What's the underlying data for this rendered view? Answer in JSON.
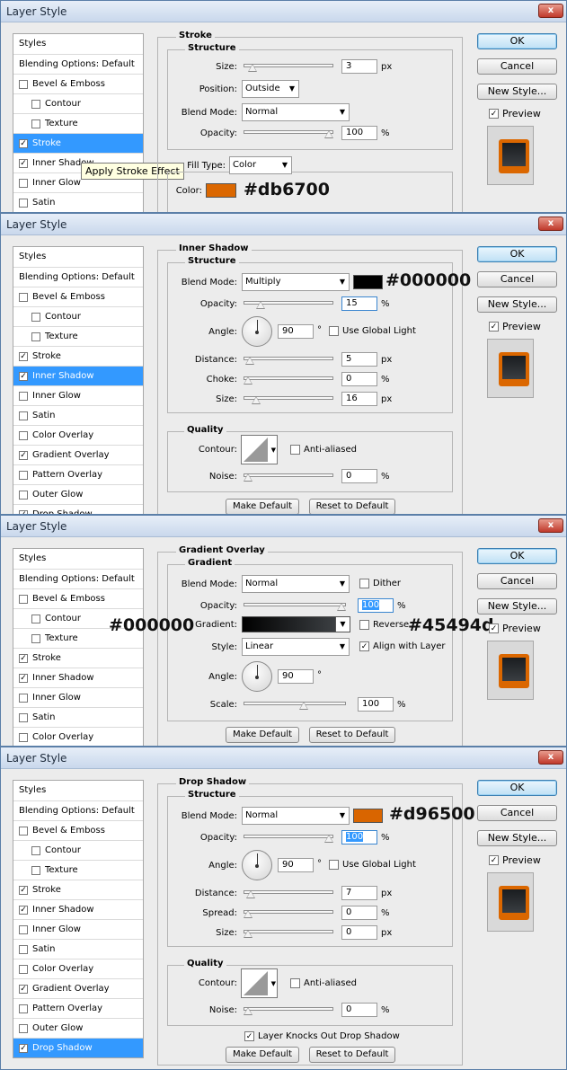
{
  "panels": [
    {
      "title": "Layer Style",
      "close_label": "x",
      "section_title": "Stroke",
      "subsection_title": "Structure",
      "sidebar": [
        {
          "label": "Styles",
          "type": "header"
        },
        {
          "label": "Blending Options: Default",
          "type": "header"
        },
        {
          "label": "Bevel & Emboss",
          "checked": false
        },
        {
          "label": "Contour",
          "checked": false,
          "indent": true
        },
        {
          "label": "Texture",
          "checked": false,
          "indent": true
        },
        {
          "label": "Stroke",
          "checked": true,
          "selected": true
        },
        {
          "label": "Inner Shadow",
          "checked": true
        },
        {
          "label": "Inner Glow",
          "checked": false
        },
        {
          "label": "Satin",
          "checked": false
        }
      ],
      "tooltip": "Apply Stroke Effect",
      "fields": {
        "size_label": "Size:",
        "size_value": "3",
        "size_unit": "px",
        "size_pos": 0.05,
        "position_label": "Position:",
        "position_value": "Outside",
        "blend_label": "Blend Mode:",
        "blend_value": "Normal",
        "opacity_label": "Opacity:",
        "opacity_value": "100",
        "opacity_unit": "%",
        "opacity_pos": 1.0,
        "fill_label": "Fill Type:",
        "fill_value": "Color",
        "color_label": "Color:",
        "color_hex": "#db6700"
      },
      "annotation": "#db6700",
      "buttons": {
        "ok": "OK",
        "cancel": "Cancel",
        "new_style": "New Style...",
        "preview": "Preview"
      }
    },
    {
      "title": "Layer Style",
      "close_label": "x",
      "section_title": "Inner Shadow",
      "subsection_title": "Structure",
      "quality_title": "Quality",
      "sidebar": [
        {
          "label": "Styles",
          "type": "header"
        },
        {
          "label": "Blending Options: Default",
          "type": "header"
        },
        {
          "label": "Bevel & Emboss",
          "checked": false
        },
        {
          "label": "Contour",
          "checked": false,
          "indent": true
        },
        {
          "label": "Texture",
          "checked": false,
          "indent": true
        },
        {
          "label": "Stroke",
          "checked": true
        },
        {
          "label": "Inner Shadow",
          "checked": true,
          "selected": true
        },
        {
          "label": "Inner Glow",
          "checked": false
        },
        {
          "label": "Satin",
          "checked": false
        },
        {
          "label": "Color Overlay",
          "checked": false
        },
        {
          "label": "Gradient Overlay",
          "checked": true
        },
        {
          "label": "Pattern Overlay",
          "checked": false
        },
        {
          "label": "Outer Glow",
          "checked": false
        },
        {
          "label": "Drop Shadow",
          "checked": true
        }
      ],
      "fields": {
        "blend_label": "Blend Mode:",
        "blend_value": "Multiply",
        "blend_color": "#000000",
        "opacity_label": "Opacity:",
        "opacity_value": "15",
        "opacity_unit": "%",
        "opacity_pos": 0.15,
        "angle_label": "Angle:",
        "angle_value": "90",
        "angle_unit": "°",
        "global_light": "Use Global Light",
        "distance_label": "Distance:",
        "distance_value": "5",
        "distance_unit": "px",
        "distance_pos": 0.02,
        "choke_label": "Choke:",
        "choke_value": "0",
        "choke_unit": "%",
        "choke_pos": 0.0,
        "size_label": "Size:",
        "size_value": "16",
        "size_unit": "px",
        "size_pos": 0.1,
        "contour_label": "Contour:",
        "anti_aliased": "Anti-aliased",
        "noise_label": "Noise:",
        "noise_value": "0",
        "noise_unit": "%",
        "noise_pos": 0.0,
        "make_default": "Make Default",
        "reset_default": "Reset to Default"
      },
      "annotation": "#000000",
      "buttons": {
        "ok": "OK",
        "cancel": "Cancel",
        "new_style": "New Style...",
        "preview": "Preview"
      }
    },
    {
      "title": "Layer Style",
      "close_label": "x",
      "section_title": "Gradient Overlay",
      "subsection_title": "Gradient",
      "sidebar": [
        {
          "label": "Styles",
          "type": "header"
        },
        {
          "label": "Blending Options: Default",
          "type": "header"
        },
        {
          "label": "Bevel & Emboss",
          "checked": false
        },
        {
          "label": "Contour",
          "checked": false,
          "indent": true
        },
        {
          "label": "Texture",
          "checked": false,
          "indent": true
        },
        {
          "label": "Stroke",
          "checked": true
        },
        {
          "label": "Inner Shadow",
          "checked": true
        },
        {
          "label": "Inner Glow",
          "checked": false
        },
        {
          "label": "Satin",
          "checked": false
        },
        {
          "label": "Color Overlay",
          "checked": false
        }
      ],
      "fields": {
        "blend_label": "Blend Mode:",
        "blend_value": "Normal",
        "dither": "Dither",
        "opacity_label": "Opacity:",
        "opacity_value": "100",
        "opacity_unit": "%",
        "opacity_pos": 1.0,
        "gradient_label": "Gradient:",
        "reverse": "Reverse",
        "gradient_start": "#000000",
        "gradient_end": "#45494d",
        "style_label": "Style:",
        "style_value": "Linear",
        "align_layer": "Align with Layer",
        "angle_label": "Angle:",
        "angle_value": "90",
        "angle_unit": "°",
        "scale_label": "Scale:",
        "scale_value": "100",
        "scale_unit": "%",
        "scale_pos": 0.6,
        "make_default": "Make Default",
        "reset_default": "Reset to Default"
      },
      "annotation_left": "#000000",
      "annotation_right": "#45494d",
      "buttons": {
        "ok": "OK",
        "cancel": "Cancel",
        "new_style": "New Style...",
        "preview": "Preview"
      }
    },
    {
      "title": "Layer Style",
      "close_label": "x",
      "section_title": "Drop Shadow",
      "subsection_title": "Structure",
      "quality_title": "Quality",
      "sidebar": [
        {
          "label": "Styles",
          "type": "header"
        },
        {
          "label": "Blending Options: Default",
          "type": "header"
        },
        {
          "label": "Bevel & Emboss",
          "checked": false
        },
        {
          "label": "Contour",
          "checked": false,
          "indent": true
        },
        {
          "label": "Texture",
          "checked": false,
          "indent": true
        },
        {
          "label": "Stroke",
          "checked": true
        },
        {
          "label": "Inner Shadow",
          "checked": true
        },
        {
          "label": "Inner Glow",
          "checked": false
        },
        {
          "label": "Satin",
          "checked": false
        },
        {
          "label": "Color Overlay",
          "checked": false
        },
        {
          "label": "Gradient Overlay",
          "checked": true
        },
        {
          "label": "Pattern Overlay",
          "checked": false
        },
        {
          "label": "Outer Glow",
          "checked": false
        },
        {
          "label": "Drop Shadow",
          "checked": true,
          "selected": true
        }
      ],
      "fields": {
        "blend_label": "Blend Mode:",
        "blend_value": "Normal",
        "blend_color": "#d96500",
        "opacity_label": "Opacity:",
        "opacity_value": "100",
        "opacity_unit": "%",
        "opacity_pos": 1.0,
        "angle_label": "Angle:",
        "angle_value": "90",
        "angle_unit": "°",
        "global_light": "Use Global Light",
        "distance_label": "Distance:",
        "distance_value": "7",
        "distance_unit": "px",
        "distance_pos": 0.03,
        "spread_label": "Spread:",
        "spread_value": "0",
        "spread_unit": "%",
        "spread_pos": 0.0,
        "size_label": "Size:",
        "size_value": "0",
        "size_unit": "px",
        "size_pos": 0.0,
        "contour_label": "Contour:",
        "anti_aliased": "Anti-aliased",
        "noise_label": "Noise:",
        "noise_value": "0",
        "noise_unit": "%",
        "noise_pos": 0.0,
        "knockout": "Layer Knocks Out Drop Shadow",
        "make_default": "Make Default",
        "reset_default": "Reset to Default"
      },
      "annotation": "#d96500",
      "buttons": {
        "ok": "OK",
        "cancel": "Cancel",
        "new_style": "New Style...",
        "preview": "Preview"
      }
    }
  ]
}
